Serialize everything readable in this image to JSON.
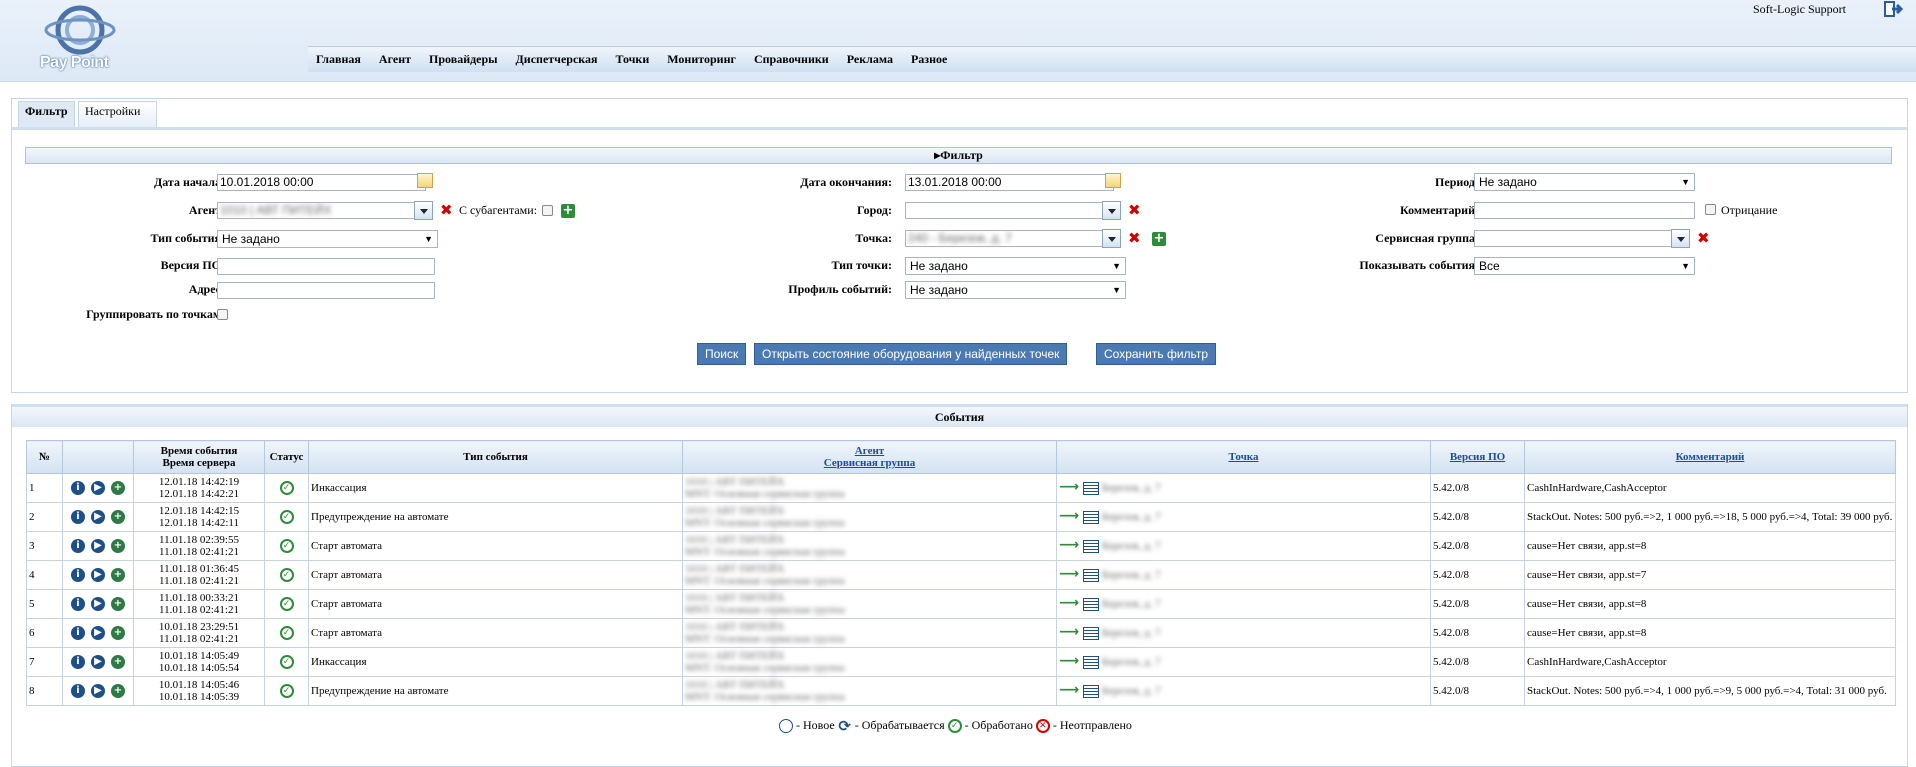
{
  "header": {
    "logo_text": "Pay Point",
    "user_name": "Soft-Logic Support"
  },
  "menu": [
    "Главная",
    "Агент",
    "Провайдеры",
    "Диспетчерская",
    "Точки",
    "Мониторинг",
    "Справочники",
    "Реклама",
    "Разное"
  ],
  "tabs": [
    "Фильтр",
    "Настройки"
  ],
  "filter": {
    "title": "Фильтр",
    "date_start_label": "Дата начала:",
    "date_start": "10.01.2018 00:00",
    "date_end_label": "Дата окончания:",
    "date_end": "13.01.2018 00:00",
    "period_label": "Период:",
    "period": "Не задано",
    "agent_label": "Агент:",
    "agent_value": "1010 | АВТ ПИТЕЙХ",
    "subagents_label": "С субагентами:",
    "city_label": "Город:",
    "comment_label": "Комментарий:",
    "negation_label": "Отрицание",
    "event_type_label": "Тип события:",
    "event_type": "Не задано",
    "point_label": "Точка:",
    "point_value": "240 - Березов, д. 7",
    "service_group_label": "Сервисная группа:",
    "version_label": "Версия ПО:",
    "point_type_label": "Тип точки:",
    "point_type": "Не задано",
    "show_events_label": "Показывать события:",
    "show_events": "Все",
    "address_label": "Адрес:",
    "event_profile_label": "Профиль событий:",
    "event_profile": "Не задано",
    "group_by_points_label": "Группировать по точкам:",
    "btn_search": "Поиск",
    "btn_open_state": "Открыть состояние оборудования у найденных точек",
    "btn_save": "Сохранить фильтр"
  },
  "events": {
    "title": "События",
    "columns": {
      "num": "№",
      "time_event": "Время события",
      "time_server": "Время сервера",
      "status": "Статус",
      "type": "Тип события",
      "agent": "Агент",
      "service_group": "Сервисная группа",
      "point": "Точка",
      "version": "Версия ПО",
      "comment": "Комментарий"
    },
    "rows": [
      {
        "n": "1",
        "t1": "12.01.18 14:42:19",
        "t2": "12.01.18 14:42:21",
        "type": "Инкассация",
        "agent": "1010 | АВТ ПИТЕЙХ",
        "group": "MNT: Основная сервисная группа",
        "point": "Березов, д. 7",
        "ver": "5.42.0/8",
        "comment": "CashInHardware,CashAcceptor"
      },
      {
        "n": "2",
        "t1": "12.01.18 14:42:15",
        "t2": "12.01.18 14:42:11",
        "type": "Предупреждение на автомате",
        "agent": "1010 | АВТ ПИТЕЙХ",
        "group": "MNT: Основная сервисная группа",
        "point": "Березов, д. 7",
        "ver": "5.42.0/8",
        "comment": "StackOut. Notes: 500 руб.=>2, 1 000 руб.=>18, 5 000 руб.=>4, Total: 39 000 руб."
      },
      {
        "n": "3",
        "t1": "11.01.18 02:39:55",
        "t2": "11.01.18 02:41:21",
        "type": "Старт автомата",
        "agent": "1010 | АВТ ПИТЕЙХ",
        "group": "MNT: Основная сервисная группа",
        "point": "Березов, д. 7",
        "ver": "5.42.0/8",
        "comment": "cause=Нет связи, app.st=8"
      },
      {
        "n": "4",
        "t1": "11.01.18 01:36:45",
        "t2": "11.01.18 02:41:21",
        "type": "Старт автомата",
        "agent": "1010 | АВТ ПИТЕЙХ",
        "group": "MNT: Основная сервисная группа",
        "point": "Березов, д. 7",
        "ver": "5.42.0/8",
        "comment": "cause=Нет связи, app.st=7"
      },
      {
        "n": "5",
        "t1": "11.01.18 00:33:21",
        "t2": "11.01.18 02:41:21",
        "type": "Старт автомата",
        "agent": "1010 | АВТ ПИТЕЙХ",
        "group": "MNT: Основная сервисная группа",
        "point": "Березов, д. 7",
        "ver": "5.42.0/8",
        "comment": "cause=Нет связи, app.st=8"
      },
      {
        "n": "6",
        "t1": "10.01.18 23:29:51",
        "t2": "11.01.18 02:41:21",
        "type": "Старт автомата",
        "agent": "1010 | АВТ ПИТЕЙХ",
        "group": "MNT: Основная сервисная группа",
        "point": "Березов, д. 7",
        "ver": "5.42.0/8",
        "comment": "cause=Нет связи, app.st=8"
      },
      {
        "n": "7",
        "t1": "10.01.18 14:05:49",
        "t2": "10.01.18 14:05:54",
        "type": "Инкассация",
        "agent": "1010 | АВТ ПИТЕЙХ",
        "group": "MNT: Основная сервисная группа",
        "point": "Березов, д. 7",
        "ver": "5.42.0/8",
        "comment": "CashInHardware,CashAcceptor"
      },
      {
        "n": "8",
        "t1": "10.01.18 14:05:46",
        "t2": "10.01.18 14:05:39",
        "type": "Предупреждение на автомате",
        "agent": "1010 | АВТ ПИТЕЙХ",
        "group": "MNT: Основная сервисная группа",
        "point": "Березов, д. 7",
        "ver": "5.42.0/8",
        "comment": "StackOut. Notes: 500 руб.=>4, 1 000 руб.=>9, 5 000 руб.=>4, Total: 31 000 руб."
      }
    ]
  },
  "legend": {
    "new": "- Новое",
    "processing": "- Обрабатывается",
    "processed": "- Обработано",
    "not_sent": "- Неотправлено"
  }
}
